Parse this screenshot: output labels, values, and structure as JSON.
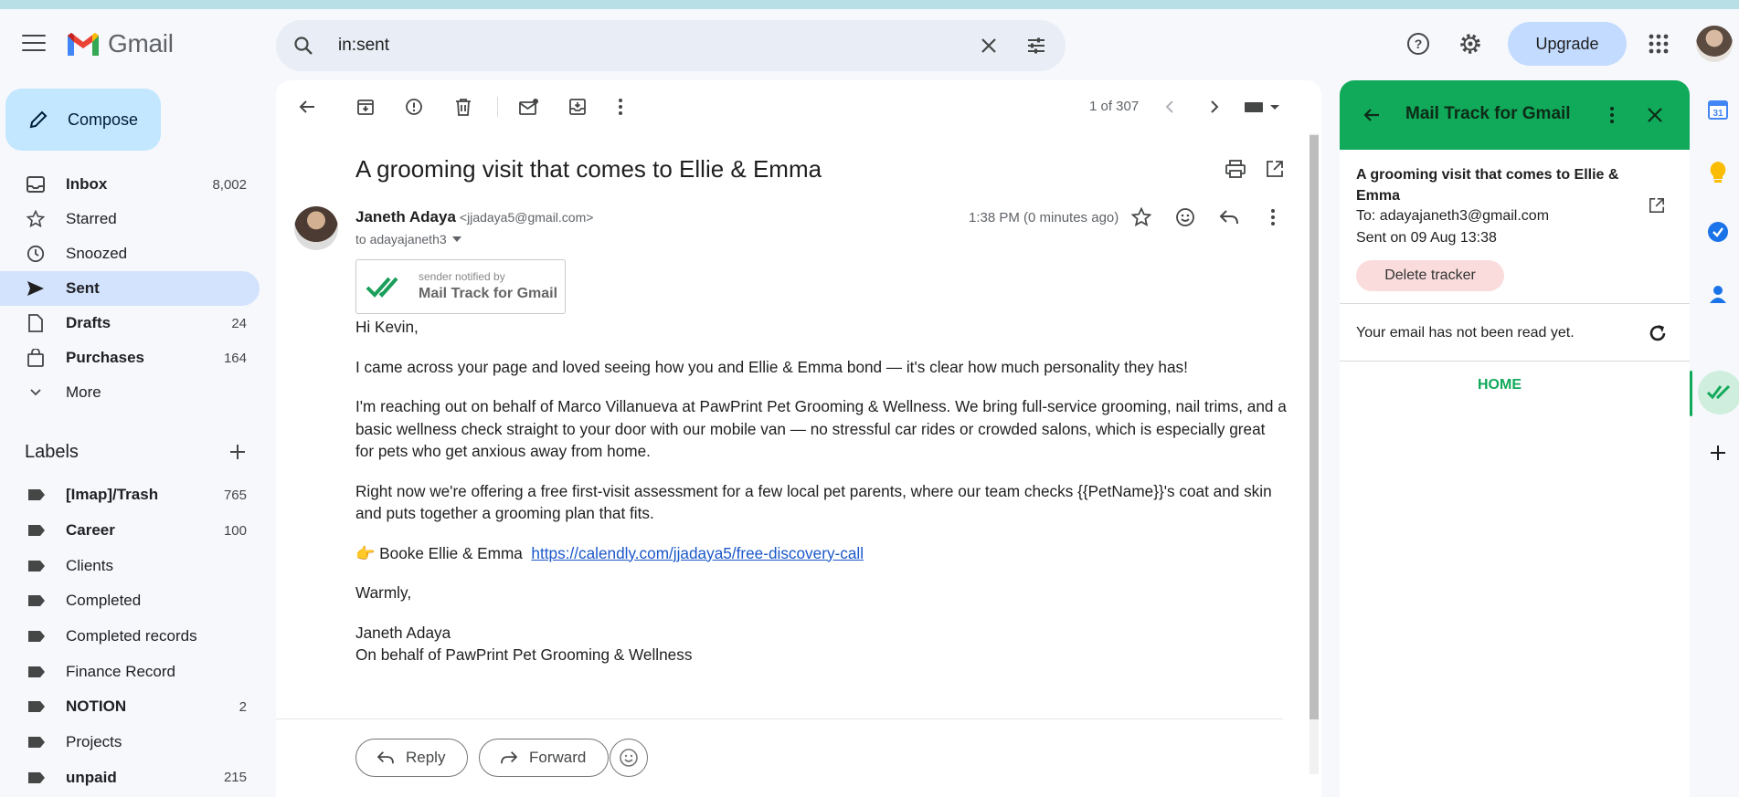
{
  "header": {
    "app_name": "Gmail",
    "search_value": "in:sent",
    "upgrade_label": "Upgrade"
  },
  "sidebar": {
    "compose_label": "Compose",
    "items": [
      {
        "label": "Inbox",
        "count": "8,002",
        "icon": "inbox-icon"
      },
      {
        "label": "Starred",
        "count": "",
        "icon": "star-icon"
      },
      {
        "label": "Snoozed",
        "count": "",
        "icon": "clock-icon"
      },
      {
        "label": "Sent",
        "count": "",
        "icon": "send-icon"
      },
      {
        "label": "Drafts",
        "count": "24",
        "icon": "draft-icon"
      },
      {
        "label": "Purchases",
        "count": "164",
        "icon": "shopping-bag-icon"
      },
      {
        "label": "More",
        "count": "",
        "icon": "chevron-down-icon"
      }
    ],
    "labels_heading": "Labels",
    "labels": [
      {
        "label": "[Imap]/Trash",
        "count": "765"
      },
      {
        "label": "Career",
        "count": "100"
      },
      {
        "label": "Clients",
        "count": ""
      },
      {
        "label": "Completed",
        "count": ""
      },
      {
        "label": "Completed records",
        "count": ""
      },
      {
        "label": "Finance Record",
        "count": ""
      },
      {
        "label": "NOTION",
        "count": "2"
      },
      {
        "label": "Projects",
        "count": ""
      },
      {
        "label": "unpaid",
        "count": "215"
      }
    ]
  },
  "toolbar": {
    "pager": "1 of 307"
  },
  "email": {
    "subject": "A grooming visit that comes to Ellie & Emma",
    "sender_name": "Janeth Adaya",
    "sender_email": "<jjadaya5@gmail.com>",
    "to_line": "to adayajaneth3",
    "time": "1:38 PM (0 minutes ago)",
    "badge_small": "sender notified by",
    "badge_big": "Mail Track for Gmail",
    "greeting": "Hi Kevin,",
    "para1": "I came across your page and loved seeing how you and Ellie & Emma bond — it's clear how much personality they has!",
    "para2": "I'm reaching out on behalf of Marco Villanueva at PawPrint Pet Grooming & Wellness. We bring full-service grooming, nail trims, and a basic wellness check straight to your door with our mobile van — no stressful car rides or crowded salons, which is especially great for pets who get anxious away from home.",
    "para3": "Right now we're offering a free first-visit assessment for a few local pet parents, where our team checks {{PetName}}'s coat and skin and puts together a grooming plan that fits.",
    "cta_prefix": "👉 Booke Ellie & Emma",
    "cta_link": "https://calendly.com/jjadaya5/free-discovery-call",
    "signoff": "Warmly,",
    "sig_name": "Janeth Adaya",
    "sig_line": "On behalf of PawPrint Pet Grooming & Wellness",
    "reply_label": "Reply",
    "forward_label": "Forward"
  },
  "mailtrack": {
    "title": "Mail Track for Gmail",
    "subject": "A grooming visit that comes to Ellie & Emma",
    "to": "To: adayajaneth3@gmail.com",
    "sent": "Sent on 09 Aug 13:38",
    "delete_label": "Delete tracker",
    "status": "Your email has not been read yet.",
    "home_label": "HOME"
  },
  "colors": {
    "accent_green": "#11a95a",
    "compose_bg": "#c2e7ff",
    "active_nav_bg": "#d3e3fd",
    "link_blue": "#1a57c9"
  },
  "rail": {
    "calendar_label": "31"
  }
}
